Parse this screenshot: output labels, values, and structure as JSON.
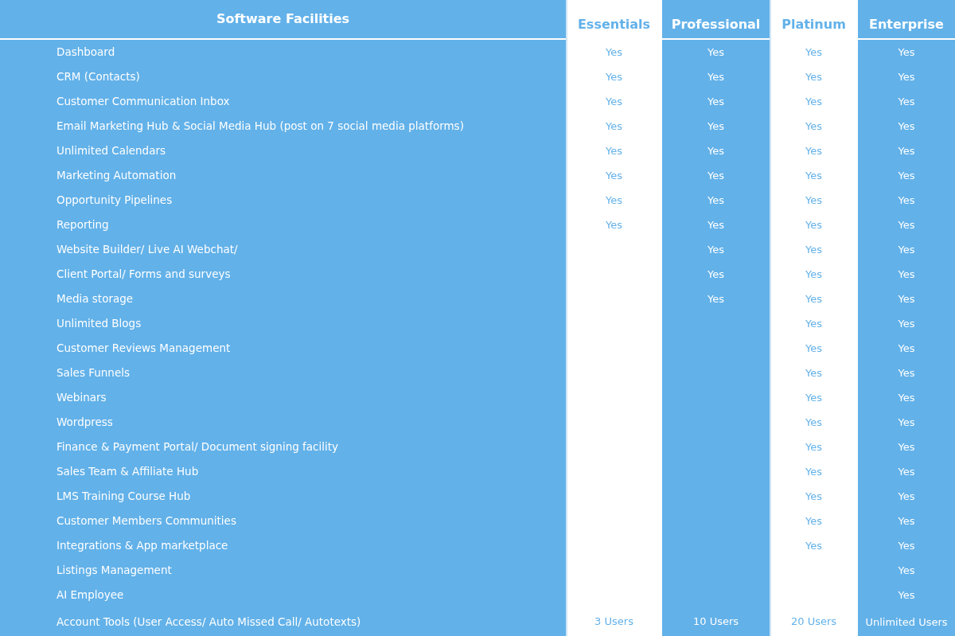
{
  "header": {
    "title": "Software Facilities"
  },
  "features": [
    "Dashboard",
    "CRM (Contacts)",
    "Customer Communication Inbox",
    "Email Marketing Hub & Social Media Hub (post on 7 social media platforms)",
    "Unlimited Calendars",
    "Marketing Automation",
    "Opportunity Pipelines",
    "Reporting",
    "Website Builder/ Live AI Webchat/",
    "Client Portal/ Forms and surveys",
    "Media storage",
    "Unlimited Blogs",
    "Customer Reviews Management",
    "Sales Funnels",
    "Webinars",
    "Wordpress",
    "Finance & Payment Portal/ Document signing facility",
    "Sales Team & Affiliate Hub",
    "LMS Training Course Hub",
    "Customer Members Communities",
    "Integrations & App marketplace",
    "Listings Management",
    "AI Employee",
    "Account Tools (User Access/ Auto Missed Call/ Autotexts)"
  ],
  "plans": [
    {
      "name": "Essentials",
      "highlight": true,
      "cells": [
        {
          "text": "Yes"
        },
        {
          "text": "Yes"
        },
        {
          "text": "Yes"
        },
        {
          "text": "Yes"
        },
        {
          "text": "Yes"
        },
        {
          "text": "Yes"
        },
        {
          "text": "Yes"
        },
        {
          "text": "Yes"
        },
        {
          "text": "3 Users",
          "kind": "users"
        }
      ]
    },
    {
      "name": "Professional",
      "highlight": false,
      "cells": [
        {
          "text": "Yes"
        },
        {
          "text": "Yes"
        },
        {
          "text": "Yes"
        },
        {
          "text": "Yes"
        },
        {
          "text": "Yes"
        },
        {
          "text": "Yes"
        },
        {
          "text": "Yes"
        },
        {
          "text": "Yes"
        },
        {
          "text": "Yes"
        },
        {
          "text": "Yes"
        },
        {
          "text": "Yes"
        },
        {
          "text": "10 Users",
          "kind": "users"
        }
      ]
    },
    {
      "name": "Platinum",
      "highlight": true,
      "cells": [
        {
          "text": "Yes"
        },
        {
          "text": "Yes"
        },
        {
          "text": "Yes"
        },
        {
          "text": "Yes"
        },
        {
          "text": "Yes"
        },
        {
          "text": "Yes"
        },
        {
          "text": "Yes"
        },
        {
          "text": "Yes"
        },
        {
          "text": "Yes"
        },
        {
          "text": "Yes"
        },
        {
          "text": "Yes"
        },
        {
          "text": "Yes"
        },
        {
          "text": "Yes"
        },
        {
          "text": "Yes"
        },
        {
          "text": "Yes"
        },
        {
          "text": "Yes"
        },
        {
          "text": "Yes"
        },
        {
          "text": "Yes"
        },
        {
          "text": "Yes"
        },
        {
          "text": "Yes"
        },
        {
          "text": "Yes"
        },
        {
          "text": "20 Users",
          "kind": "users"
        }
      ]
    },
    {
      "name": "Enterprise",
      "highlight": false,
      "cells": [
        {
          "text": "Yes"
        },
        {
          "text": "Yes"
        },
        {
          "text": "Yes"
        },
        {
          "text": "Yes"
        },
        {
          "text": "Yes"
        },
        {
          "text": "Yes"
        },
        {
          "text": "Yes"
        },
        {
          "text": "Yes"
        },
        {
          "text": "Yes"
        },
        {
          "text": "Yes"
        },
        {
          "text": "Yes"
        },
        {
          "text": "Yes"
        },
        {
          "text": "Yes"
        },
        {
          "text": "Yes"
        },
        {
          "text": "Yes"
        },
        {
          "text": "Yes"
        },
        {
          "text": "Yes"
        },
        {
          "text": "Yes"
        },
        {
          "text": "Yes"
        },
        {
          "text": "Yes"
        },
        {
          "text": "Yes"
        },
        {
          "text": "Yes"
        },
        {
          "text": "Yes"
        },
        {
          "text": "Unlimited Users",
          "kind": "users"
        }
      ]
    }
  ]
}
